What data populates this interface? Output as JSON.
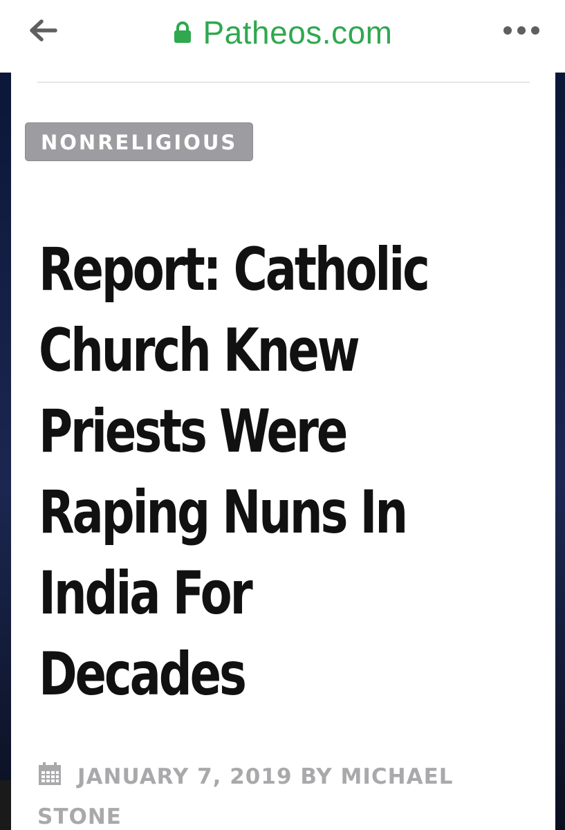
{
  "browser": {
    "domain": "Patheos.com",
    "icons": {
      "back": "arrow-left-icon",
      "secure": "lock-icon",
      "menu": "more-horizontal-icon"
    },
    "colors": {
      "domain_text": "#2fa84f",
      "icon_gray": "#5f5f5f"
    }
  },
  "article": {
    "category": "NONRELIGIOUS",
    "headline_lines": [
      "Report: Catholic",
      "Church Knew",
      "Priests Were",
      "Raping Nuns In",
      "India For",
      "Decades"
    ],
    "date": "JANUARY 7, 2019",
    "by_label": "BY",
    "author_first": "MICHAEL",
    "author_last": "STONE",
    "icons": {
      "date": "calendar-icon"
    },
    "colors": {
      "badge_bg": "#9d9da1",
      "headline": "#111111",
      "meta": "#a9a9ab"
    }
  }
}
